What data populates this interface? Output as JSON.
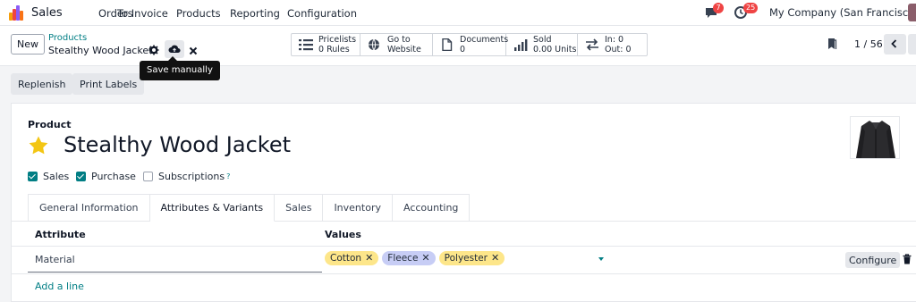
{
  "app": {
    "name": "Sales",
    "menu": [
      "Orders",
      "To Invoice",
      "Products",
      "Reporting",
      "Configuration"
    ],
    "messages_badge": "7",
    "activities_badge": "25",
    "company": "My Company (San Francisco)"
  },
  "control": {
    "new_label": "New",
    "breadcrumb_parent": "Products",
    "breadcrumb_current": "Stealthy Wood Jacket",
    "tooltip": "Save manually",
    "smart_buttons": [
      {
        "line1": "Pricelists",
        "line2": "0 Rules"
      },
      {
        "line1": "Go to",
        "line2": "Website"
      },
      {
        "line1": "Documents",
        "line2": "0"
      },
      {
        "line1": "Sold",
        "line2": "0.00 Units"
      },
      {
        "line1": "In: 0",
        "line2": "Out: 0"
      }
    ],
    "pager": "1 / 56"
  },
  "actions": {
    "replenish": "Replenish",
    "print_labels": "Print Labels"
  },
  "form": {
    "product_label": "Product",
    "product_name": "Stealthy Wood Jacket",
    "checkboxes": [
      {
        "label": "Sales",
        "checked": true
      },
      {
        "label": "Purchase",
        "checked": true
      },
      {
        "label": "Subscriptions",
        "checked": false,
        "help": "?"
      }
    ],
    "tabs": [
      "General Information",
      "Attributes & Variants",
      "Sales",
      "Inventory",
      "Accounting"
    ],
    "active_tab": "Attributes & Variants",
    "table": {
      "headers": [
        "Attribute",
        "Values"
      ],
      "rows": [
        {
          "attribute": "Material",
          "values": [
            {
              "label": "Cotton",
              "color": "#fde68a"
            },
            {
              "label": "Fleece",
              "color": "#c7cdf5"
            },
            {
              "label": "Polyester",
              "color": "#fde68a"
            }
          ],
          "configure": "Configure"
        }
      ],
      "add_line": "Add a line"
    }
  },
  "colors": {
    "accent": "#017e84",
    "badge": "#ef4444"
  }
}
